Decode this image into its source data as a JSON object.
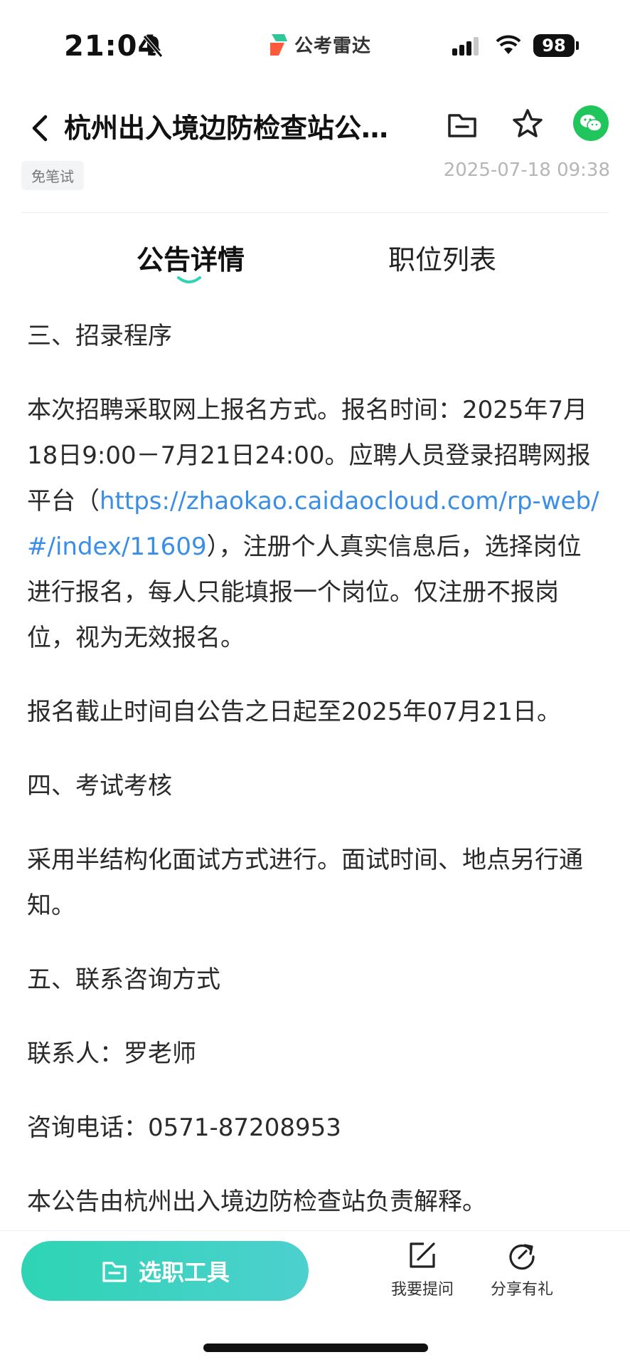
{
  "status_bar": {
    "time": "21:04",
    "brand": "公考雷达",
    "battery": "98",
    "icons": [
      "bell-muted-icon",
      "signal-icon",
      "wifi-icon",
      "battery-icon"
    ]
  },
  "header": {
    "title": "杭州出入境边防检查站公开招聘警务辅助人员公告",
    "tag": "免笔试",
    "date": "2025-07-18 09:38",
    "icons": [
      "back-icon",
      "folder-icon",
      "star-icon",
      "wechat-icon"
    ]
  },
  "tabs": [
    {
      "label": "公告详情",
      "active": true
    },
    {
      "label": "职位列表",
      "active": false
    }
  ],
  "content": {
    "sec3_title": "三、招录程序",
    "p1_before": "本次招聘采取网上报名方式。报名时间：2025年7月18日9:00－7月21日24:00。应聘人员登录招聘网报平台（",
    "p1_link": "https://zhaokao.caidaocloud.com/rp-web/#/index/11609",
    "p1_after": "），注册个人真实信息后，选择岗位进行报名，每人只能填报一个岗位。仅注册不报岗位，视为无效报名。",
    "p2": "报名截止时间自公告之日起至2025年07月21日。",
    "sec4_title": "四、考试考核",
    "p3": "采用半结构化面试方式进行。面试时间、地点另行通知。",
    "sec5_title": "五、联系咨询方式",
    "contact": "联系人：罗老师",
    "phone": "咨询电话：0571-87208953",
    "footer_note": "本公告由杭州出入境边防检查站负责解释。"
  },
  "bottom_bar": {
    "tool_button": "选职工具",
    "ask": "我要提问",
    "share": "分享有礼"
  },
  "colors": {
    "accent_gradient_start": "#2ed4b4",
    "accent_gradient_end": "#4dd0cf",
    "link": "#3a8ee6",
    "wechat": "#20c65c"
  }
}
